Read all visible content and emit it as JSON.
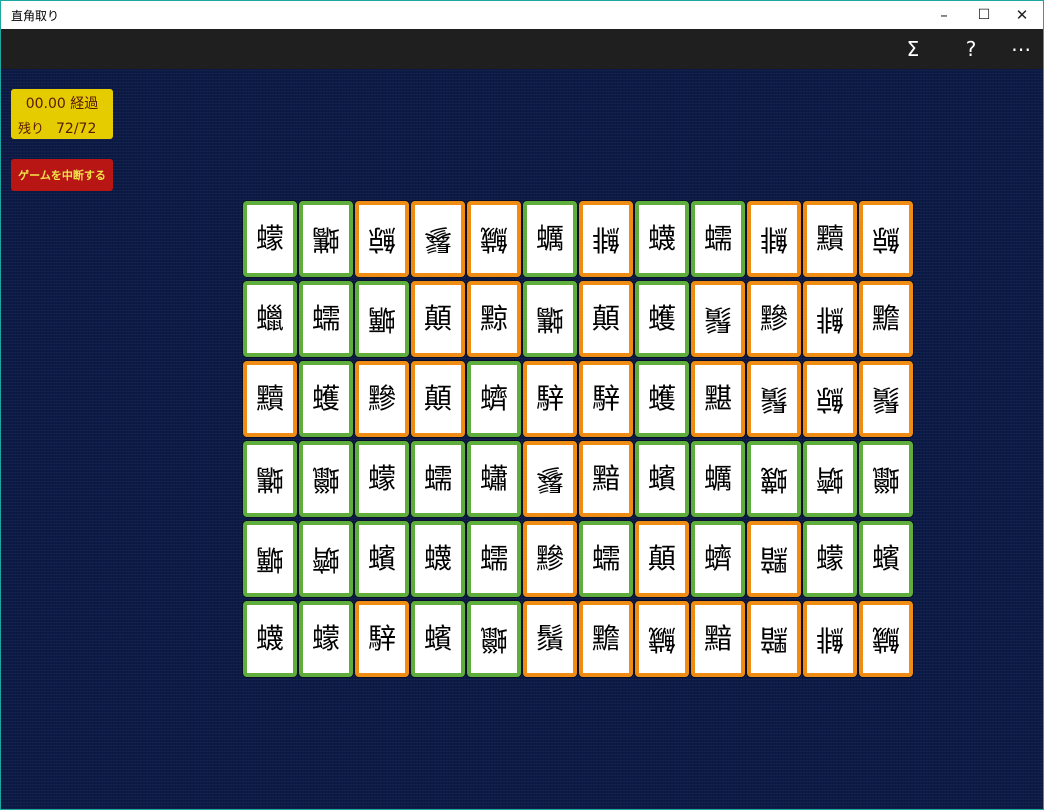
{
  "window": {
    "title": "直角取り"
  },
  "window_controls": {
    "minimize": "–",
    "maximize": "☐",
    "close": "✕"
  },
  "appbar": {
    "sigma": "Σ",
    "help": "?",
    "more": "⋯"
  },
  "status": {
    "elapsed": "00.00 経過",
    "remaining_label": "残り",
    "remaining_count": "72/72"
  },
  "abort_button": {
    "label": "ゲームを中断する"
  },
  "colors": {
    "green_border": "#5fad3c",
    "orange_border": "#ef8c14",
    "board": "#0b1a46",
    "status_box": "#e5cc00",
    "abort_button": "#b81515"
  },
  "tiles": [
    [
      {
        "c": "蠓",
        "b": "green",
        "f": false
      },
      {
        "c": "蠵",
        "b": "green",
        "f": true
      },
      {
        "c": "鯨",
        "b": "orange",
        "f": true
      },
      {
        "c": "鬖",
        "b": "orange",
        "f": true
      },
      {
        "c": "鱥",
        "b": "orange",
        "f": true
      },
      {
        "c": "蠣",
        "b": "green",
        "f": false
      },
      {
        "c": "鯡",
        "b": "orange",
        "f": true
      },
      {
        "c": "蠛",
        "b": "green",
        "f": false
      },
      {
        "c": "蠕",
        "b": "green",
        "f": false
      },
      {
        "c": "鯡",
        "b": "orange",
        "f": true
      },
      {
        "c": "黷",
        "b": "orange",
        "f": false
      },
      {
        "c": "鯨",
        "b": "orange",
        "f": true
      }
    ],
    [
      {
        "c": "蠟",
        "b": "green",
        "f": false
      },
      {
        "c": "蠕",
        "b": "green",
        "f": false
      },
      {
        "c": "蠣",
        "b": "green",
        "f": true
      },
      {
        "c": "顛",
        "b": "orange",
        "f": false
      },
      {
        "c": "黥",
        "b": "orange",
        "f": false
      },
      {
        "c": "蠵",
        "b": "green",
        "f": true
      },
      {
        "c": "顛",
        "b": "orange",
        "f": false
      },
      {
        "c": "蠖",
        "b": "green",
        "f": false
      },
      {
        "c": "鬚",
        "b": "orange",
        "f": true
      },
      {
        "c": "黲",
        "b": "orange",
        "f": false
      },
      {
        "c": "鯡",
        "b": "orange",
        "f": true
      },
      {
        "c": "黵",
        "b": "orange",
        "f": false
      }
    ],
    [
      {
        "c": "黷",
        "b": "orange",
        "f": false
      },
      {
        "c": "蠖",
        "b": "green",
        "f": false
      },
      {
        "c": "黲",
        "b": "orange",
        "f": false
      },
      {
        "c": "顛",
        "b": "orange",
        "f": false
      },
      {
        "c": "蠐",
        "b": "green",
        "f": false
      },
      {
        "c": "騂",
        "b": "orange",
        "f": false
      },
      {
        "c": "騂",
        "b": "orange",
        "f": false
      },
      {
        "c": "蠖",
        "b": "green",
        "f": false
      },
      {
        "c": "黮",
        "b": "orange",
        "f": false
      },
      {
        "c": "鬚",
        "b": "orange",
        "f": true
      },
      {
        "c": "鯨",
        "b": "orange",
        "f": true
      },
      {
        "c": "鬚",
        "b": "orange",
        "f": true
      }
    ],
    [
      {
        "c": "蠵",
        "b": "green",
        "f": true
      },
      {
        "c": "蠟",
        "b": "green",
        "f": true
      },
      {
        "c": "蠓",
        "b": "green",
        "f": false
      },
      {
        "c": "蠕",
        "b": "green",
        "f": false
      },
      {
        "c": "蠨",
        "b": "green",
        "f": false
      },
      {
        "c": "鬖",
        "b": "orange",
        "f": true
      },
      {
        "c": "黯",
        "b": "orange",
        "f": false
      },
      {
        "c": "蠙",
        "b": "green",
        "f": false
      },
      {
        "c": "蠣",
        "b": "green",
        "f": false
      },
      {
        "c": "蠛",
        "b": "green",
        "f": true
      },
      {
        "c": "蠐",
        "b": "green",
        "f": true
      },
      {
        "c": "蠟",
        "b": "green",
        "f": true
      }
    ],
    [
      {
        "c": "蠣",
        "b": "green",
        "f": true
      },
      {
        "c": "蠐",
        "b": "green",
        "f": true
      },
      {
        "c": "蠙",
        "b": "green",
        "f": false
      },
      {
        "c": "蠛",
        "b": "green",
        "f": false
      },
      {
        "c": "蠕",
        "b": "green",
        "f": false
      },
      {
        "c": "黲",
        "b": "orange",
        "f": false
      },
      {
        "c": "蠕",
        "b": "green",
        "f": false
      },
      {
        "c": "顛",
        "b": "orange",
        "f": false
      },
      {
        "c": "蠐",
        "b": "green",
        "f": false
      },
      {
        "c": "黯",
        "b": "orange",
        "f": true
      },
      {
        "c": "蠓",
        "b": "green",
        "f": false
      },
      {
        "c": "蠙",
        "b": "green",
        "f": false
      }
    ],
    [
      {
        "c": "蠛",
        "b": "green",
        "f": false
      },
      {
        "c": "蠓",
        "b": "green",
        "f": false
      },
      {
        "c": "騂",
        "b": "orange",
        "f": false
      },
      {
        "c": "蠙",
        "b": "green",
        "f": false
      },
      {
        "c": "蠟",
        "b": "green",
        "f": true
      },
      {
        "c": "鬚",
        "b": "orange",
        "f": false
      },
      {
        "c": "黵",
        "b": "orange",
        "f": false
      },
      {
        "c": "鱥",
        "b": "orange",
        "f": true
      },
      {
        "c": "黯",
        "b": "orange",
        "f": false
      },
      {
        "c": "黯",
        "b": "orange",
        "f": true
      },
      {
        "c": "鯡",
        "b": "orange",
        "f": true
      },
      {
        "c": "鱥",
        "b": "orange",
        "f": true
      }
    ]
  ]
}
